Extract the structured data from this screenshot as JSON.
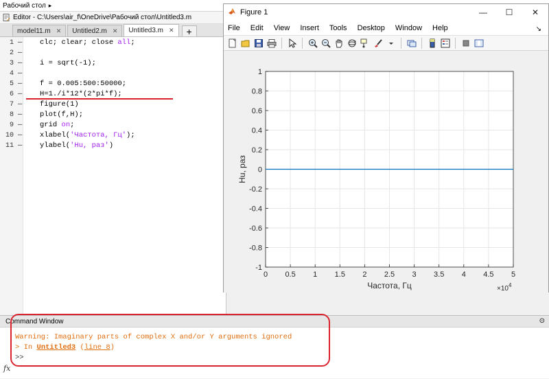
{
  "address": {
    "path": "Рабочий стол"
  },
  "editor": {
    "title": "Editor - C:\\Users\\air_f\\OneDrive\\Рабочий стол\\Untitled3.m",
    "tabs": [
      {
        "label": "model11.m"
      },
      {
        "label": "Untitled2.m"
      },
      {
        "label": "Untitled3.m",
        "active": true
      }
    ],
    "add_tab_label": "+",
    "lines": [
      {
        "n": "1",
        "code": "clc; clear; close ",
        "kw": "all",
        "tail": ";"
      },
      {
        "n": "2",
        "code": ""
      },
      {
        "n": "3",
        "code": "i = sqrt(-1);"
      },
      {
        "n": "4",
        "code": ""
      },
      {
        "n": "5",
        "code": "f = 0.005:500:50000;"
      },
      {
        "n": "6",
        "code": "H=1./i*12*(2*pi*f);"
      },
      {
        "n": "7",
        "code": "figure(1)"
      },
      {
        "n": "8",
        "code": "plot(f,H);"
      },
      {
        "n": "9",
        "code": "grid ",
        "kw": "on",
        "tail": ";"
      },
      {
        "n": "10",
        "code": "xlabel(",
        "str": "'Частота, Гц'",
        "tail": ");"
      },
      {
        "n": "11",
        "code": "ylabel(",
        "str": "'Hu, раз'",
        "tail": ")"
      }
    ]
  },
  "figure": {
    "title": "Figure 1",
    "win_min": "—",
    "win_max": "☐",
    "win_close": "✕",
    "menu": [
      "File",
      "Edit",
      "View",
      "Insert",
      "Tools",
      "Desktop",
      "Window",
      "Help"
    ],
    "menu_pin": "↘"
  },
  "chart_data": {
    "type": "line",
    "xlabel": "Частота, Гц",
    "ylabel": "Hu, раз",
    "x_multiplier": "×10",
    "x_multiplier_exp": "4",
    "xlim": [
      0,
      5
    ],
    "ylim": [
      -1,
      1
    ],
    "xticks": [
      "0",
      "0.5",
      "1",
      "1.5",
      "2",
      "2.5",
      "3",
      "3.5",
      "4",
      "4.5",
      "5"
    ],
    "yticks": [
      "1",
      "0.8",
      "0.6",
      "0.4",
      "0.2",
      "0",
      "-0.2",
      "-0.4",
      "-0.6",
      "-0.8",
      "-1"
    ],
    "grid": true,
    "series": [
      {
        "x": [
          0.0,
          5.0
        ],
        "y": [
          0,
          0
        ],
        "color": "#0072bd"
      }
    ]
  },
  "command_window": {
    "title": "Command Window",
    "warning": "Warning: Imaginary parts of complex X and/or Y arguments ignored",
    "in_prefix": "> In ",
    "in_file": "Untitled3",
    "in_line": "line 8",
    "prompt": ">>",
    "fx": "fx"
  }
}
